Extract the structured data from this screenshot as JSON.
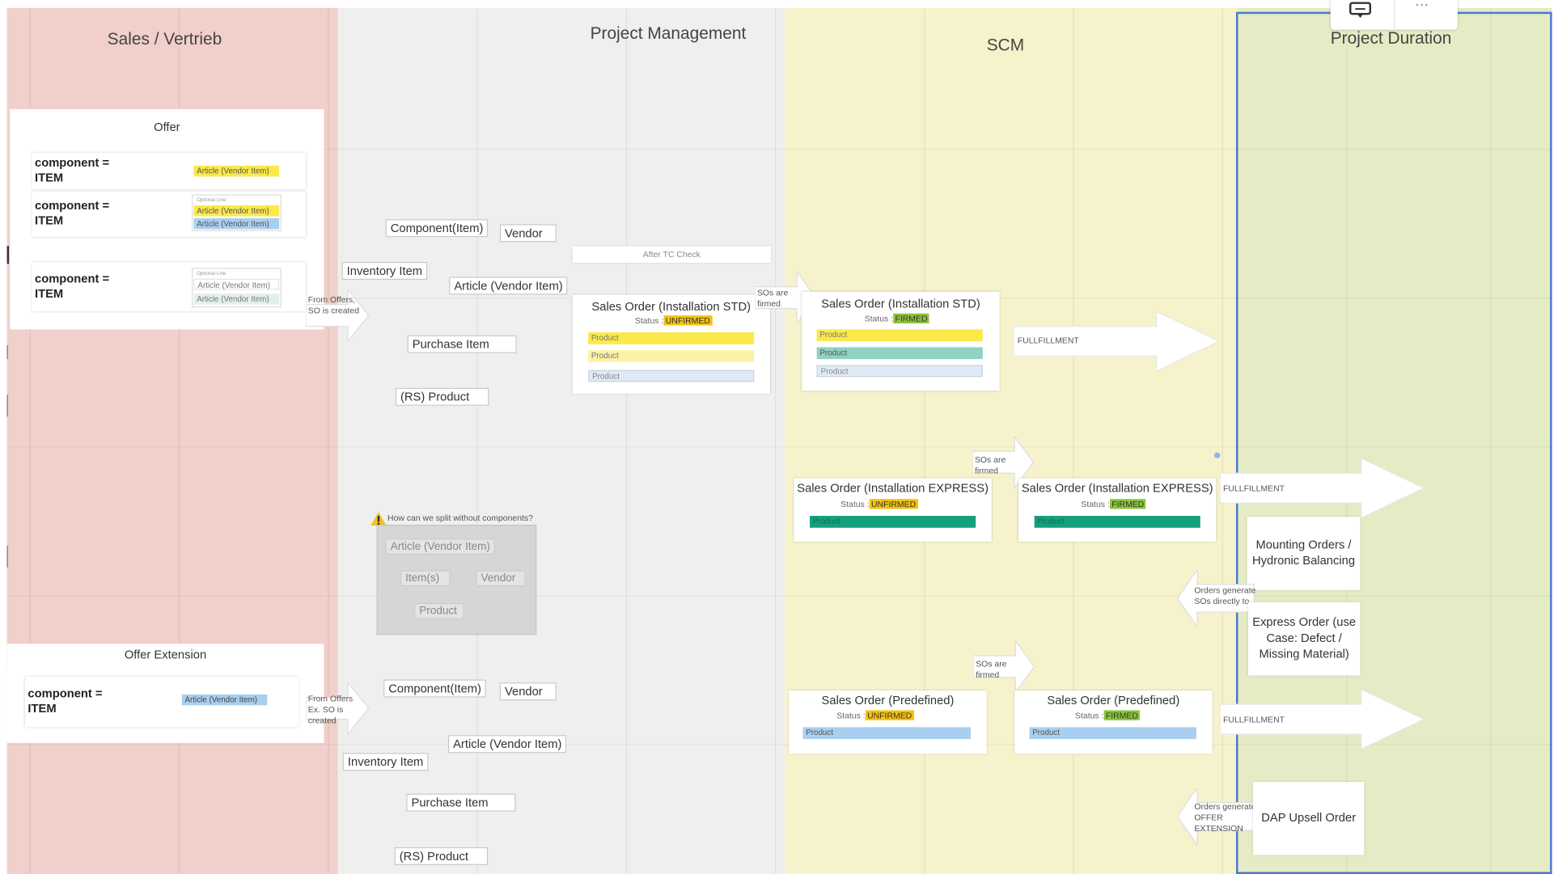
{
  "colors": {
    "sales_lane": "#f1cfca",
    "pm_lane": "#efefee",
    "scm_lane": "#f6f2cb",
    "duration_lane": "#e5ebc4",
    "yellow": "#fbe94a",
    "blue": "#a9cff0",
    "teal": "#8fd2c3",
    "green_dark": "#15a07d",
    "lightblue": "#dfeaf6",
    "status_unfirmed": "#f4c20d",
    "status_firmed": "#8cc43d",
    "selection": "#4a78d2"
  },
  "lanes": {
    "sales": "Sales / Vertrieb",
    "pm": "Project Management",
    "scm": "SCM",
    "duration": "Project Duration"
  },
  "offer": {
    "title": "Offer",
    "groups": [
      {
        "label": "component = ITEM",
        "tags": [
          "Article (Vendor Item)"
        ]
      },
      {
        "label": "component = ITEM",
        "header": "Optional Line",
        "tags": [
          "Article (Vendor Item)",
          "Article (Vendor Item)"
        ]
      },
      {
        "label": "component = ITEM",
        "header": "Optional Line",
        "tags": [
          "Article (Vendor Item)",
          "Article (Vendor Item)"
        ]
      }
    ],
    "from_note": "From Offers, SO is created"
  },
  "offer_ext": {
    "title": "Offer Extension",
    "group": {
      "label": "component = ITEM",
      "tag": "Article (Vendor Item)"
    },
    "from_note": "From Offers Ex. SO is created"
  },
  "pm_top": {
    "component": "Component(Item)",
    "vendor": "Vendor",
    "inventory": "Inventory Item",
    "article": "Article (Vendor Item)",
    "purchase": "Purchase Item",
    "rs_product": "(RS) Product"
  },
  "pm_bottom": {
    "component": "Component(Item)",
    "vendor": "Vendor",
    "inventory": "Inventory Item",
    "article": "Article (Vendor Item)",
    "purchase": "Purchase Item",
    "rs_product": "(RS) Product"
  },
  "split": {
    "question": "How can we split without components?",
    "article": "Article (Vendor Item)",
    "items": "Item(s)",
    "vendor": "Vendor",
    "product": "Product"
  },
  "after_tc": "After TC Check",
  "status_label": "Status :",
  "unfirmed": "UNFIRMED",
  "firmed": "FIRMED",
  "product": "Product",
  "so_std_title": "Sales Order (Installation STD)",
  "so_express_title": "Sales Order (Installation EXPRESS)",
  "so_predef_title": "Sales Order (Predefined)",
  "sos_are_firmed": "SOs are firmed",
  "fulfillment_top": "FULLFILLMENT",
  "fulfillment_mid": "FULLFILLMENT",
  "fulfillment_bottom": "FULLFILLMENT",
  "right": {
    "mounting": "Mounting Orders / Hydronic Balancing",
    "express": "Express Order (use Case: Defect / Missing Material)",
    "dap": "DAP Upsell Order",
    "orders_to_so": "Orders generate SOs directly to",
    "orders_to_offer": "Orders generate OFFER EXTENSION"
  },
  "toolbar": {
    "comment_icon": "comment-icon",
    "more_icon": "more-icon",
    "more": "···"
  }
}
